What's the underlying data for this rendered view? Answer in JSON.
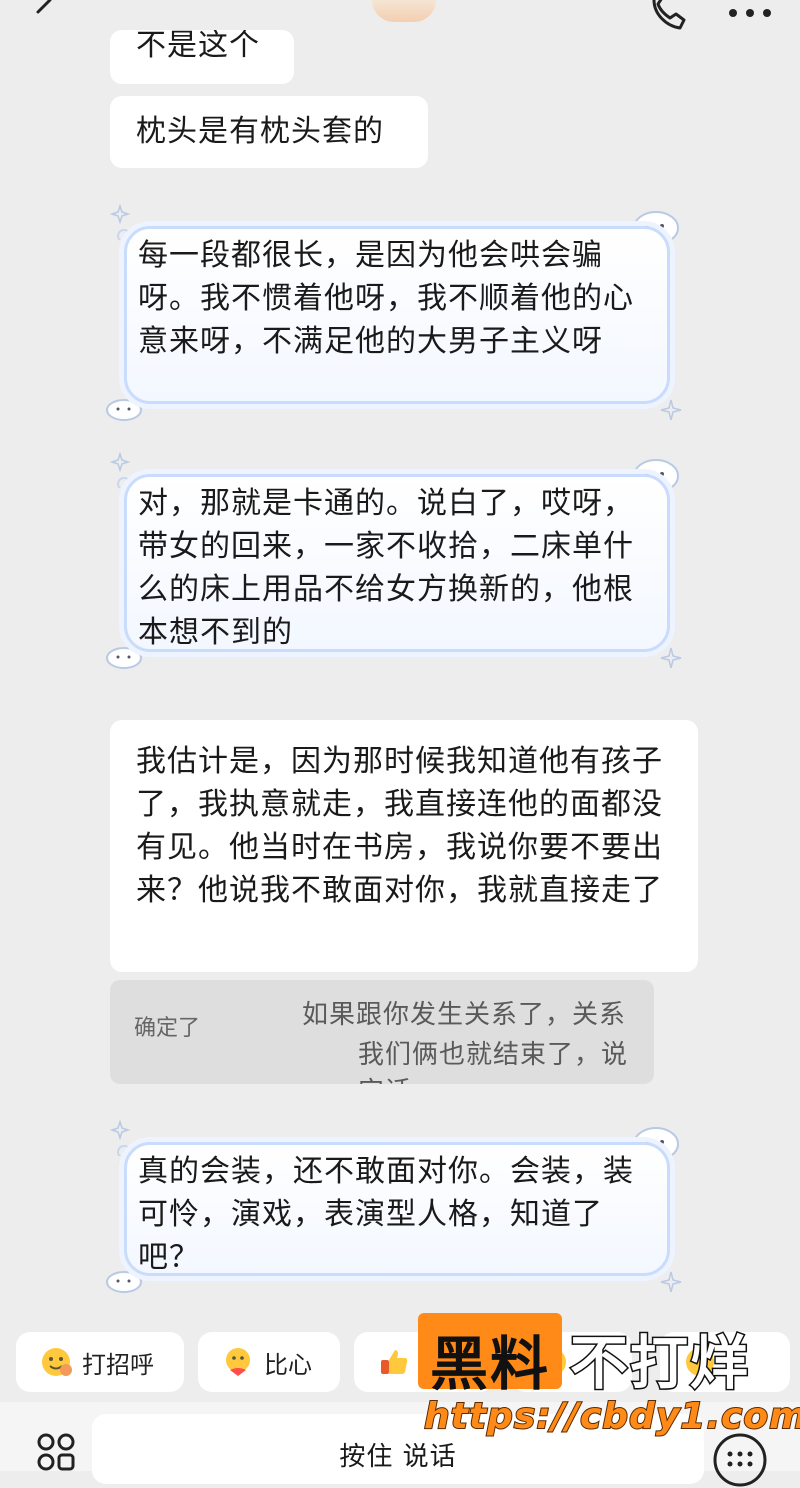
{
  "header": {
    "back_icon": "chevron-left-icon",
    "call_icon": "phone-icon",
    "more_icon": "more-icon"
  },
  "messages": [
    {
      "text": "不是这个"
    },
    {
      "text": "枕头是有枕头套的"
    },
    {
      "text": "每一段都很长，是因为他会哄会骗呀。我不惯着他呀，我不顺着他的心意来呀，不满足他的大男子主义呀"
    },
    {
      "text": "对，那就是卡通的。说白了，哎呀，带女的回来，一家不收拾，二床单什么的床上用品不给女方换新的，他根本想不到的"
    },
    {
      "text": "我估计是，因为那时候我知道他有孩子了，我执意就走，我直接连他的面都没有见。他当时在书房，我说你要不要出来？他说我不敢面对你，我就直接走了"
    },
    {
      "quote_sender": "确定了",
      "quote_line1": "如果跟你发生关系了，关系",
      "quote_line2": "我们俩也就结束了，说实话"
    },
    {
      "text": "真的会装，还不敢面对你。会装，装可怜，演戏，表演型人格，知道了吧？"
    }
  ],
  "quick_replies": [
    {
      "label": "打招呼",
      "icon": "wave-emoji-icon"
    },
    {
      "label": "比心",
      "icon": "heart-hands-emoji-icon"
    },
    {
      "label": "",
      "icon": "thumbs-up-emoji-icon"
    },
    {
      "label": "",
      "icon": "emoji-icon"
    },
    {
      "label": "",
      "icon": "emoji-icon"
    }
  ],
  "input": {
    "hold_to_talk": "按住 说话"
  },
  "watermark": {
    "box": "黑料",
    "text": "不打烊",
    "url": "https://cbdy1.com"
  }
}
